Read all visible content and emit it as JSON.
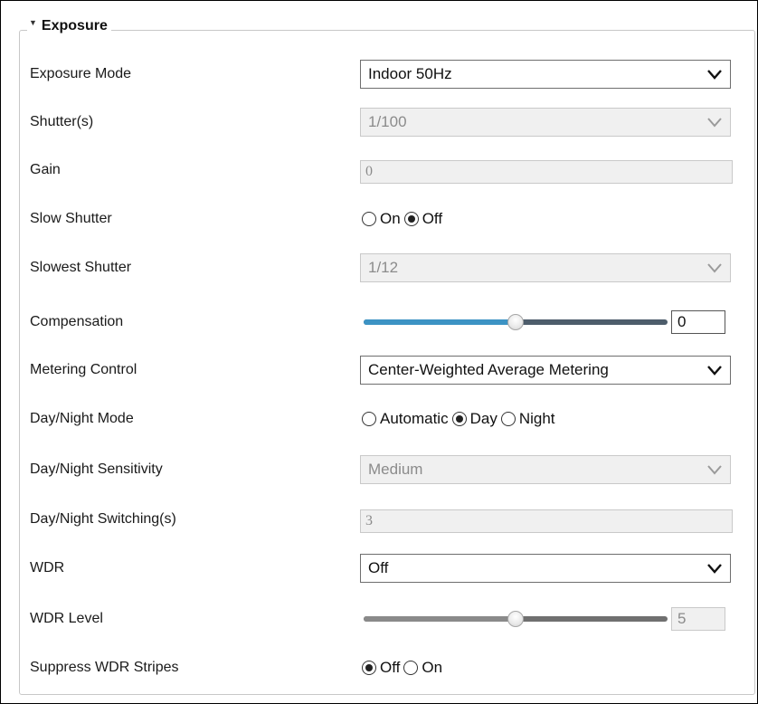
{
  "section": {
    "title": "Exposure"
  },
  "exposure_mode": {
    "label": "Exposure Mode",
    "value": "Indoor 50Hz"
  },
  "shutter": {
    "label": "Shutter(s)",
    "value": "1/100"
  },
  "gain": {
    "label": "Gain",
    "value": "0"
  },
  "slow_shutter": {
    "label": "Slow Shutter",
    "options": [
      "On",
      "Off"
    ],
    "selected": "Off"
  },
  "slowest_shutter": {
    "label": "Slowest Shutter",
    "value": "1/12"
  },
  "compensation": {
    "label": "Compensation",
    "value": "0",
    "slider_fraction": 0.5
  },
  "metering_control": {
    "label": "Metering Control",
    "value": "Center-Weighted Average Metering"
  },
  "day_night_mode": {
    "label": "Day/Night Mode",
    "options": [
      "Automatic",
      "Day",
      "Night"
    ],
    "selected": "Day"
  },
  "day_night_sensitivity": {
    "label": "Day/Night Sensitivity",
    "value": "Medium"
  },
  "day_night_switching": {
    "label": "Day/Night Switching(s)",
    "value": "3"
  },
  "wdr": {
    "label": "WDR",
    "value": "Off"
  },
  "wdr_level": {
    "label": "WDR Level",
    "value": "5",
    "slider_fraction": 0.5
  },
  "suppress_wdr_stripes": {
    "label": "Suppress WDR Stripes",
    "options": [
      "Off",
      "On"
    ],
    "selected": "Off"
  },
  "colors": {
    "slider_fill": "#3c93c4",
    "slider_track": "#4d5d6b",
    "disabled_bg": "#f0f0f0"
  }
}
